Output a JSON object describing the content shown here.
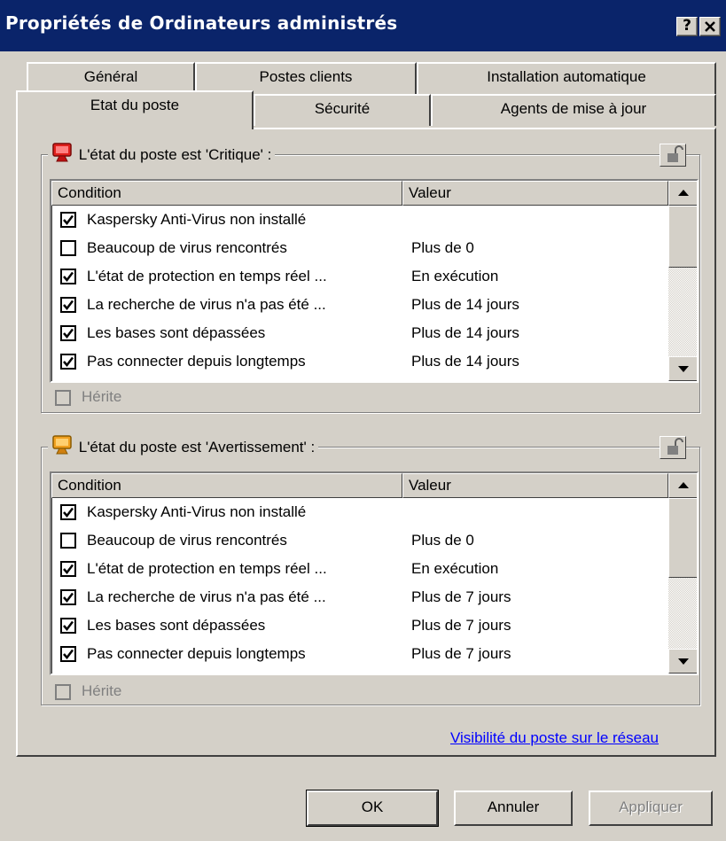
{
  "window": {
    "title": "Propriétés de Ordinateurs administrés",
    "help_label": "?",
    "close_label": "✕"
  },
  "tabs_row1": [
    "Général",
    "Postes clients",
    "Installation automatique"
  ],
  "tabs_row2": [
    "Etat du poste",
    "Sécurité",
    "Agents de mise à jour"
  ],
  "active_tab": "Etat du poste",
  "critical": {
    "title": "L'état du poste est 'Critique' :",
    "col_condition": "Condition",
    "col_value": "Valeur",
    "rows": [
      {
        "label": "Kaspersky Anti-Virus non installé",
        "value": "",
        "checked": true
      },
      {
        "label": "Beaucoup de virus rencontrés",
        "value": "Plus de 0",
        "checked": false
      },
      {
        "label": "L'état de protection en temps réel ...",
        "value": "En exécution",
        "checked": true
      },
      {
        "label": "La recherche de virus n'a pas été ...",
        "value": "Plus de 14 jours",
        "checked": true
      },
      {
        "label": "Les bases sont dépassées",
        "value": "Plus de 14 jours",
        "checked": true
      },
      {
        "label": "Pas connecter depuis longtemps",
        "value": "Plus de 14 jours",
        "checked": true
      }
    ],
    "inherit_label": "Hérite",
    "icon_color": "#e0201c"
  },
  "warning": {
    "title": "L'état du poste est 'Avertissement' :",
    "col_condition": "Condition",
    "col_value": "Valeur",
    "rows": [
      {
        "label": "Kaspersky Anti-Virus non installé",
        "value": "",
        "checked": true
      },
      {
        "label": "Beaucoup de virus rencontrés",
        "value": "Plus de 0",
        "checked": false
      },
      {
        "label": "L'état de protection en temps réel ...",
        "value": "En exécution",
        "checked": true
      },
      {
        "label": "La recherche de virus n'a pas été ...",
        "value": "Plus de 7 jours",
        "checked": true
      },
      {
        "label": "Les bases sont dépassées",
        "value": "Plus de 7 jours",
        "checked": true
      },
      {
        "label": "Pas connecter depuis longtemps",
        "value": "Plus de 7 jours",
        "checked": true
      }
    ],
    "inherit_label": "Hérite",
    "icon_color": "#f0a020"
  },
  "visibility_link": "Visibilité du poste sur le réseau",
  "buttons": {
    "ok": "OK",
    "cancel": "Annuler",
    "apply": "Appliquer"
  },
  "colors": {
    "titlebar": "#0a246a",
    "face": "#d4d0c8",
    "link": "#0000ff"
  }
}
